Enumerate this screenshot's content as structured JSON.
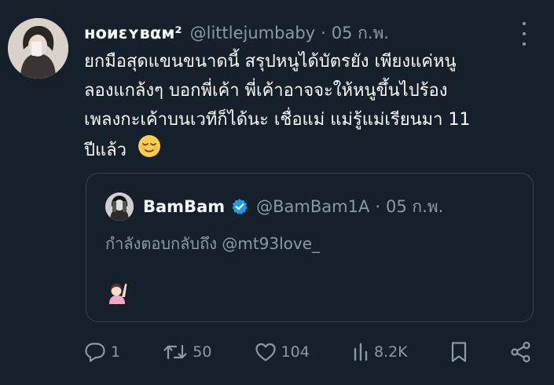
{
  "tweet": {
    "display_name": "нoиɛʏвαм²",
    "handle": "@littlejumbaby",
    "separator": "·",
    "date": "05 ก.พ.",
    "text_lines": [
      "ยกมือสุดแขนขนาดนี้ สรุปหนูได้บัตรยัง เพียงแค่หนู",
      "ลองแกล้งๆ บอกพี่เค้า พี่เค้าอาจจะให้หนูขึ้นไปร้อง",
      "เพลงกะเค้าบนเวทีก็ได้นะ เชื่อแม่ แม่รู้แม่เรียนมา 11",
      "ปีแล้ว"
    ],
    "emoji_icon": "relieved-face-emoji"
  },
  "quote": {
    "display_name": "BamBam",
    "handle": "@BamBam1A",
    "separator": "·",
    "date": "05 ก.พ.",
    "reply_text": "กำลังตอบกลับถึง @mt93love_",
    "emoji_icon": "person-raising-hand-emoji"
  },
  "actions": {
    "replies": "1",
    "retweets": "50",
    "likes": "104",
    "views": "8.2K"
  },
  "colors": {
    "background": "#15202b",
    "text": "#f7f9f9",
    "muted": "#8b98a5",
    "border": "#38444d",
    "verified": "#1d9bf0"
  }
}
